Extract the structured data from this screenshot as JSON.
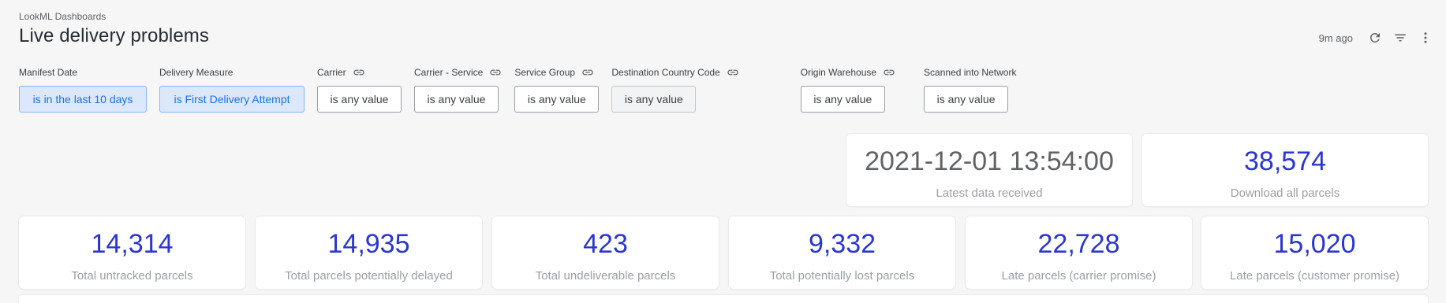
{
  "header": {
    "breadcrumb": "LookML Dashboards",
    "title": "Live delivery problems",
    "last_refreshed": "9m ago",
    "icons": [
      "refresh-icon",
      "filter-icon",
      "more-vert-icon"
    ]
  },
  "filters": [
    {
      "label": "Manifest Date",
      "value": "is in the last 10 days",
      "linked": false
    },
    {
      "label": "Delivery Measure",
      "value": "is First Delivery Attempt",
      "linked": false
    },
    {
      "label": "Carrier",
      "value": "is any value",
      "linked": true
    },
    {
      "label": "Carrier - Service",
      "value": "is any value",
      "linked": true
    },
    {
      "label": "Service Group",
      "value": "is any value",
      "linked": true
    },
    {
      "label": "Destination Country Code",
      "value": "is any value",
      "linked": true
    },
    {
      "label": "Origin Warehouse",
      "value": "is any value",
      "linked": true
    },
    {
      "label": "Scanned into Network",
      "value": "is any value",
      "linked": false
    }
  ],
  "top_tiles": [
    {
      "value": "2021-12-01 13:54:00",
      "label": "Latest data received"
    },
    {
      "value": "38,574",
      "label": "Download all parcels"
    }
  ],
  "kpi_tiles": [
    {
      "value": "14,314",
      "label": "Total untracked parcels"
    },
    {
      "value": "14,935",
      "label": "Total parcels potentially delayed"
    },
    {
      "value": "423",
      "label": "Total undeliverable parcels"
    },
    {
      "value": "9,332",
      "label": "Total potentially lost parcels"
    },
    {
      "value": "22,728",
      "label": "Late parcels (carrier promise)"
    },
    {
      "value": "15,020",
      "label": "Late parcels (customer promise)"
    }
  ],
  "colors": {
    "kpi_value": "#2a36d3",
    "active_filter_bg": "#dbe8fb",
    "active_filter_text": "#1a73e8"
  }
}
